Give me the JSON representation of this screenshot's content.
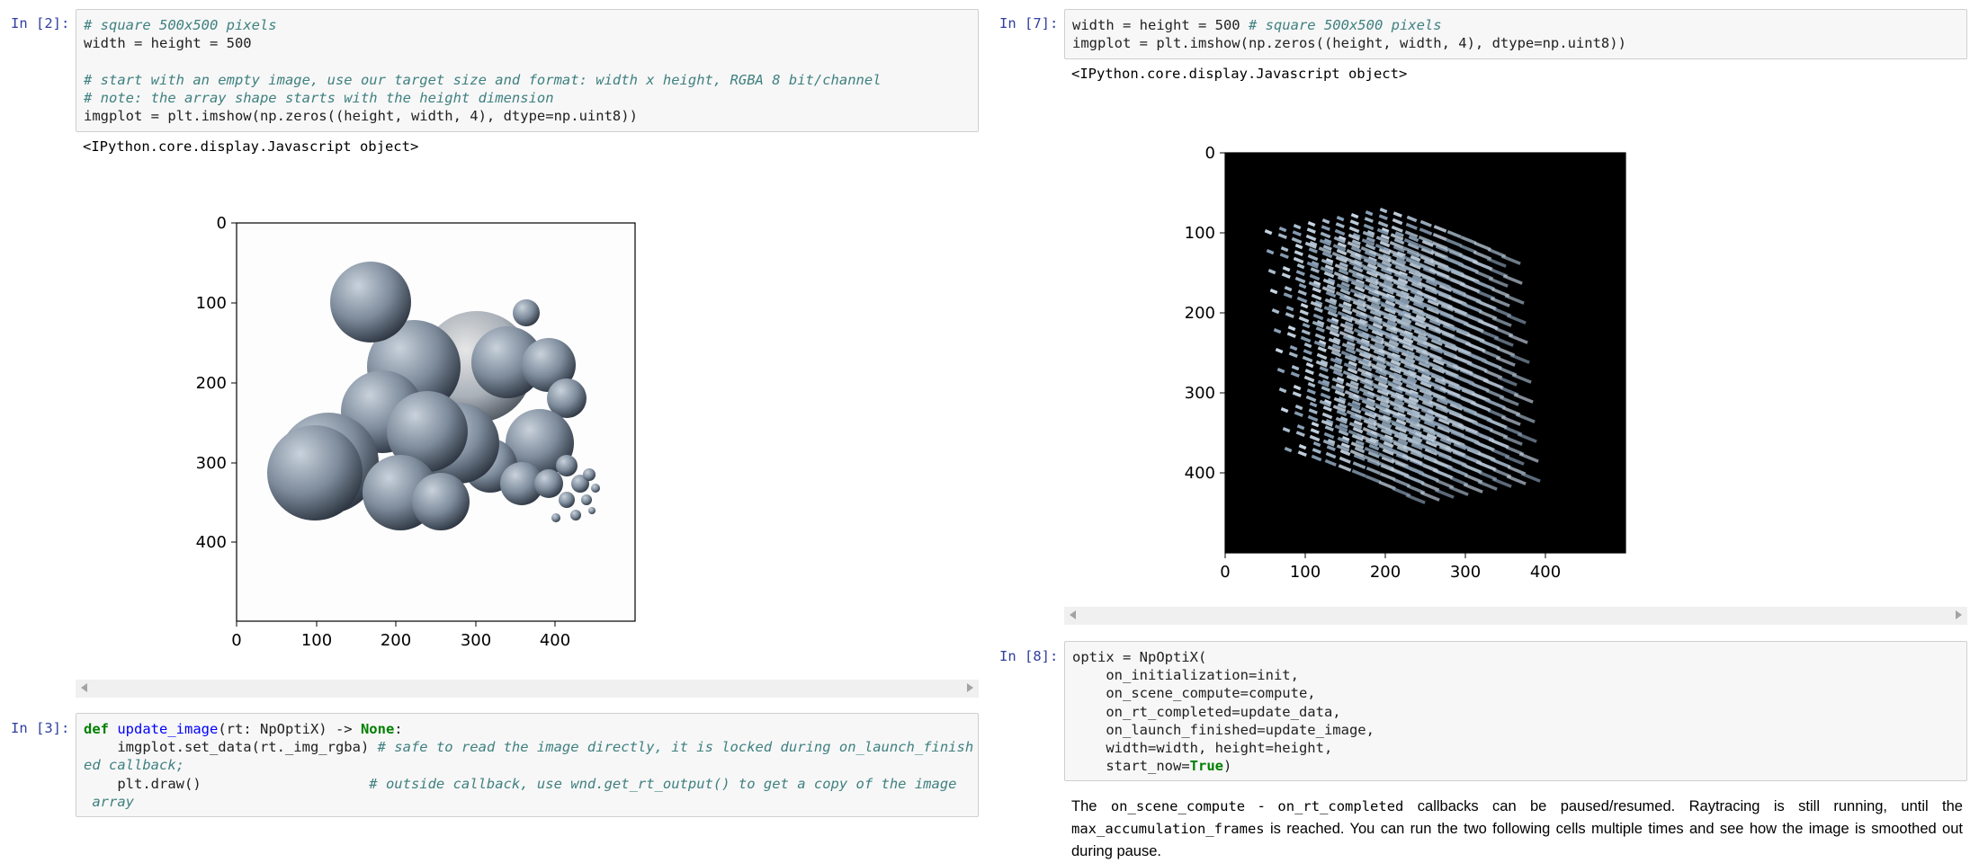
{
  "left": {
    "cell2": {
      "prompt": "In [2]:",
      "comment1": "# square 500x500 pixels",
      "line2": "width = height = 500",
      "comment2": "# start with an empty image, use our target size and format: width x height, RGBA 8 bit/channel",
      "comment3": "# note: the array shape starts with the height dimension",
      "line5": "imgplot = plt.imshow(np.zeros((height, width, 4), dtype=np.uint8))",
      "output": "<IPython.core.display.Javascript object>"
    },
    "plot": {
      "image": "3D sphere cluster render",
      "yticks": [
        "0",
        "100",
        "200",
        "300",
        "400"
      ],
      "xticks": [
        "0",
        "100",
        "200",
        "300",
        "400"
      ]
    },
    "cell3": {
      "prompt": "In [3]:",
      "def_kw": "def",
      "fn_name": "update_image",
      "sig": "(rt: NpOptiX) -> ",
      "none_kw": "None",
      "colon": ":",
      "l2_code": "    imgplot.set_data(rt._img_rgba) ",
      "l2_comment": "# safe to read the image directly, it is locked during on_launch_finish",
      "l3_comment": "ed callback;",
      "l4_code": "    plt.draw()                    ",
      "l4_comment": "# outside callback, use wnd.get_rt_output() to get a copy of the image",
      "l5_comment": " array"
    }
  },
  "right": {
    "cell7": {
      "prompt": "In [7]:",
      "line1_code": "width = height = 500 ",
      "line1_comment": "# square 500x500 pixels",
      "line2": "imgplot = plt.imshow(np.zeros((height, width, 4), dtype=np.uint8))",
      "output": "<IPython.core.display.Javascript object>"
    },
    "plot": {
      "image": "3D grid of beveled bars render",
      "yticks": [
        "0",
        "100",
        "200",
        "300",
        "400"
      ],
      "xticks": [
        "0",
        "100",
        "200",
        "300",
        "400"
      ]
    },
    "cell8": {
      "prompt": "In [8]:",
      "l1": "optix = NpOptiX(",
      "l2": "    on_initialization=init,",
      "l3": "    on_scene_compute=compute,",
      "l4": "    on_rt_completed=update_data,",
      "l5": "    on_launch_finished=update_image,",
      "l6": "    width=width, height=height,",
      "l7a": "    start_now=",
      "l7b": "True",
      "l7c": ")"
    },
    "markdown": {
      "t1": "The ",
      "c1": "on_scene_compute",
      "t2": " - ",
      "c2": "on_rt_completed",
      "t3": " callbacks can be paused/resumed. Raytracing is still running, until the ",
      "c3": "max_accumulation_frames",
      "t4": " is reached. You can run the two following cells multiple times and see how the image is smoothed out during pause."
    }
  }
}
